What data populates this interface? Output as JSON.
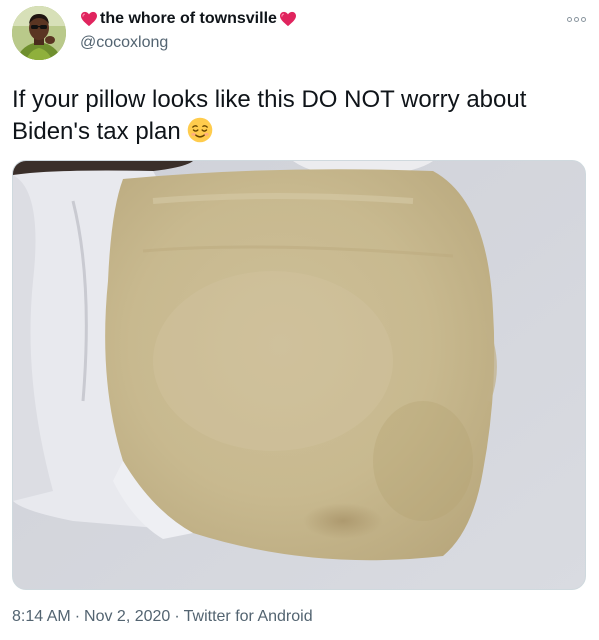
{
  "author": {
    "display_name": "the whore of townsville",
    "handle": "@cocoxlong",
    "name_decoration_icon": "red-heart-icon",
    "avatar_icon": "profile-photo"
  },
  "menu": {
    "icon": "more-options-icon"
  },
  "tweet": {
    "text": "If your pillow looks like this DO NOT worry about Biden's tax plan",
    "emoji": "relieved-face-icon"
  },
  "media": {
    "type": "photo",
    "subject": "stained-pillow-photo"
  },
  "meta": {
    "time": "8:14 AM",
    "date": "Nov 2, 2020",
    "source": "Twitter for Android",
    "separator": "·"
  },
  "colors": {
    "heart": "#e0245e",
    "secondary_text": "#536471",
    "primary_text": "#0f1419"
  }
}
